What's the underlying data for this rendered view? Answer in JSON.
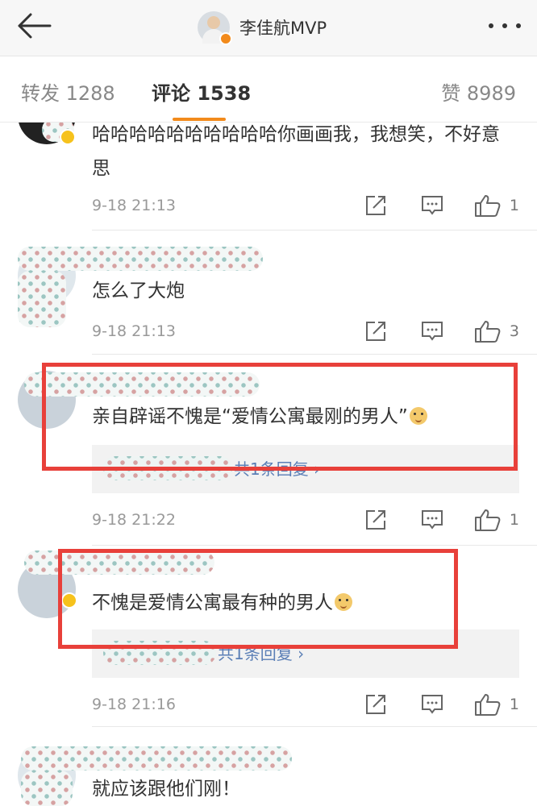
{
  "header": {
    "title": "李佳航MVP",
    "back_icon": "back-arrow-icon",
    "more_icon": "more-dots-icon"
  },
  "tabs": [
    {
      "label": "转发 1288"
    },
    {
      "label": "评论 1538"
    },
    {
      "label": "赞 8989"
    }
  ],
  "colors": {
    "accent": "#f28a1b",
    "highlight": "#e8403a",
    "link": "#5b7fb6"
  },
  "comments": [
    {
      "text": "哈哈哈哈哈哈哈哈哈哈你画画我，我想笑，不好意思",
      "time": "9-18 21:13",
      "likes": "1"
    },
    {
      "text": "怎么了大炮",
      "time": "9-18 21:13",
      "likes": "3"
    },
    {
      "text": "亲自辟谣不愧是“爱情公寓最刚的男人”",
      "time": "9-18 21:22",
      "likes": "1",
      "reply": "共1条回复 ›"
    },
    {
      "text": "不愧是爱情公寓最有种的男人",
      "time": "9-18 21:16",
      "likes": "1",
      "reply": "共1条回复 ›"
    },
    {
      "text": "就应该跟他们刚！"
    }
  ]
}
